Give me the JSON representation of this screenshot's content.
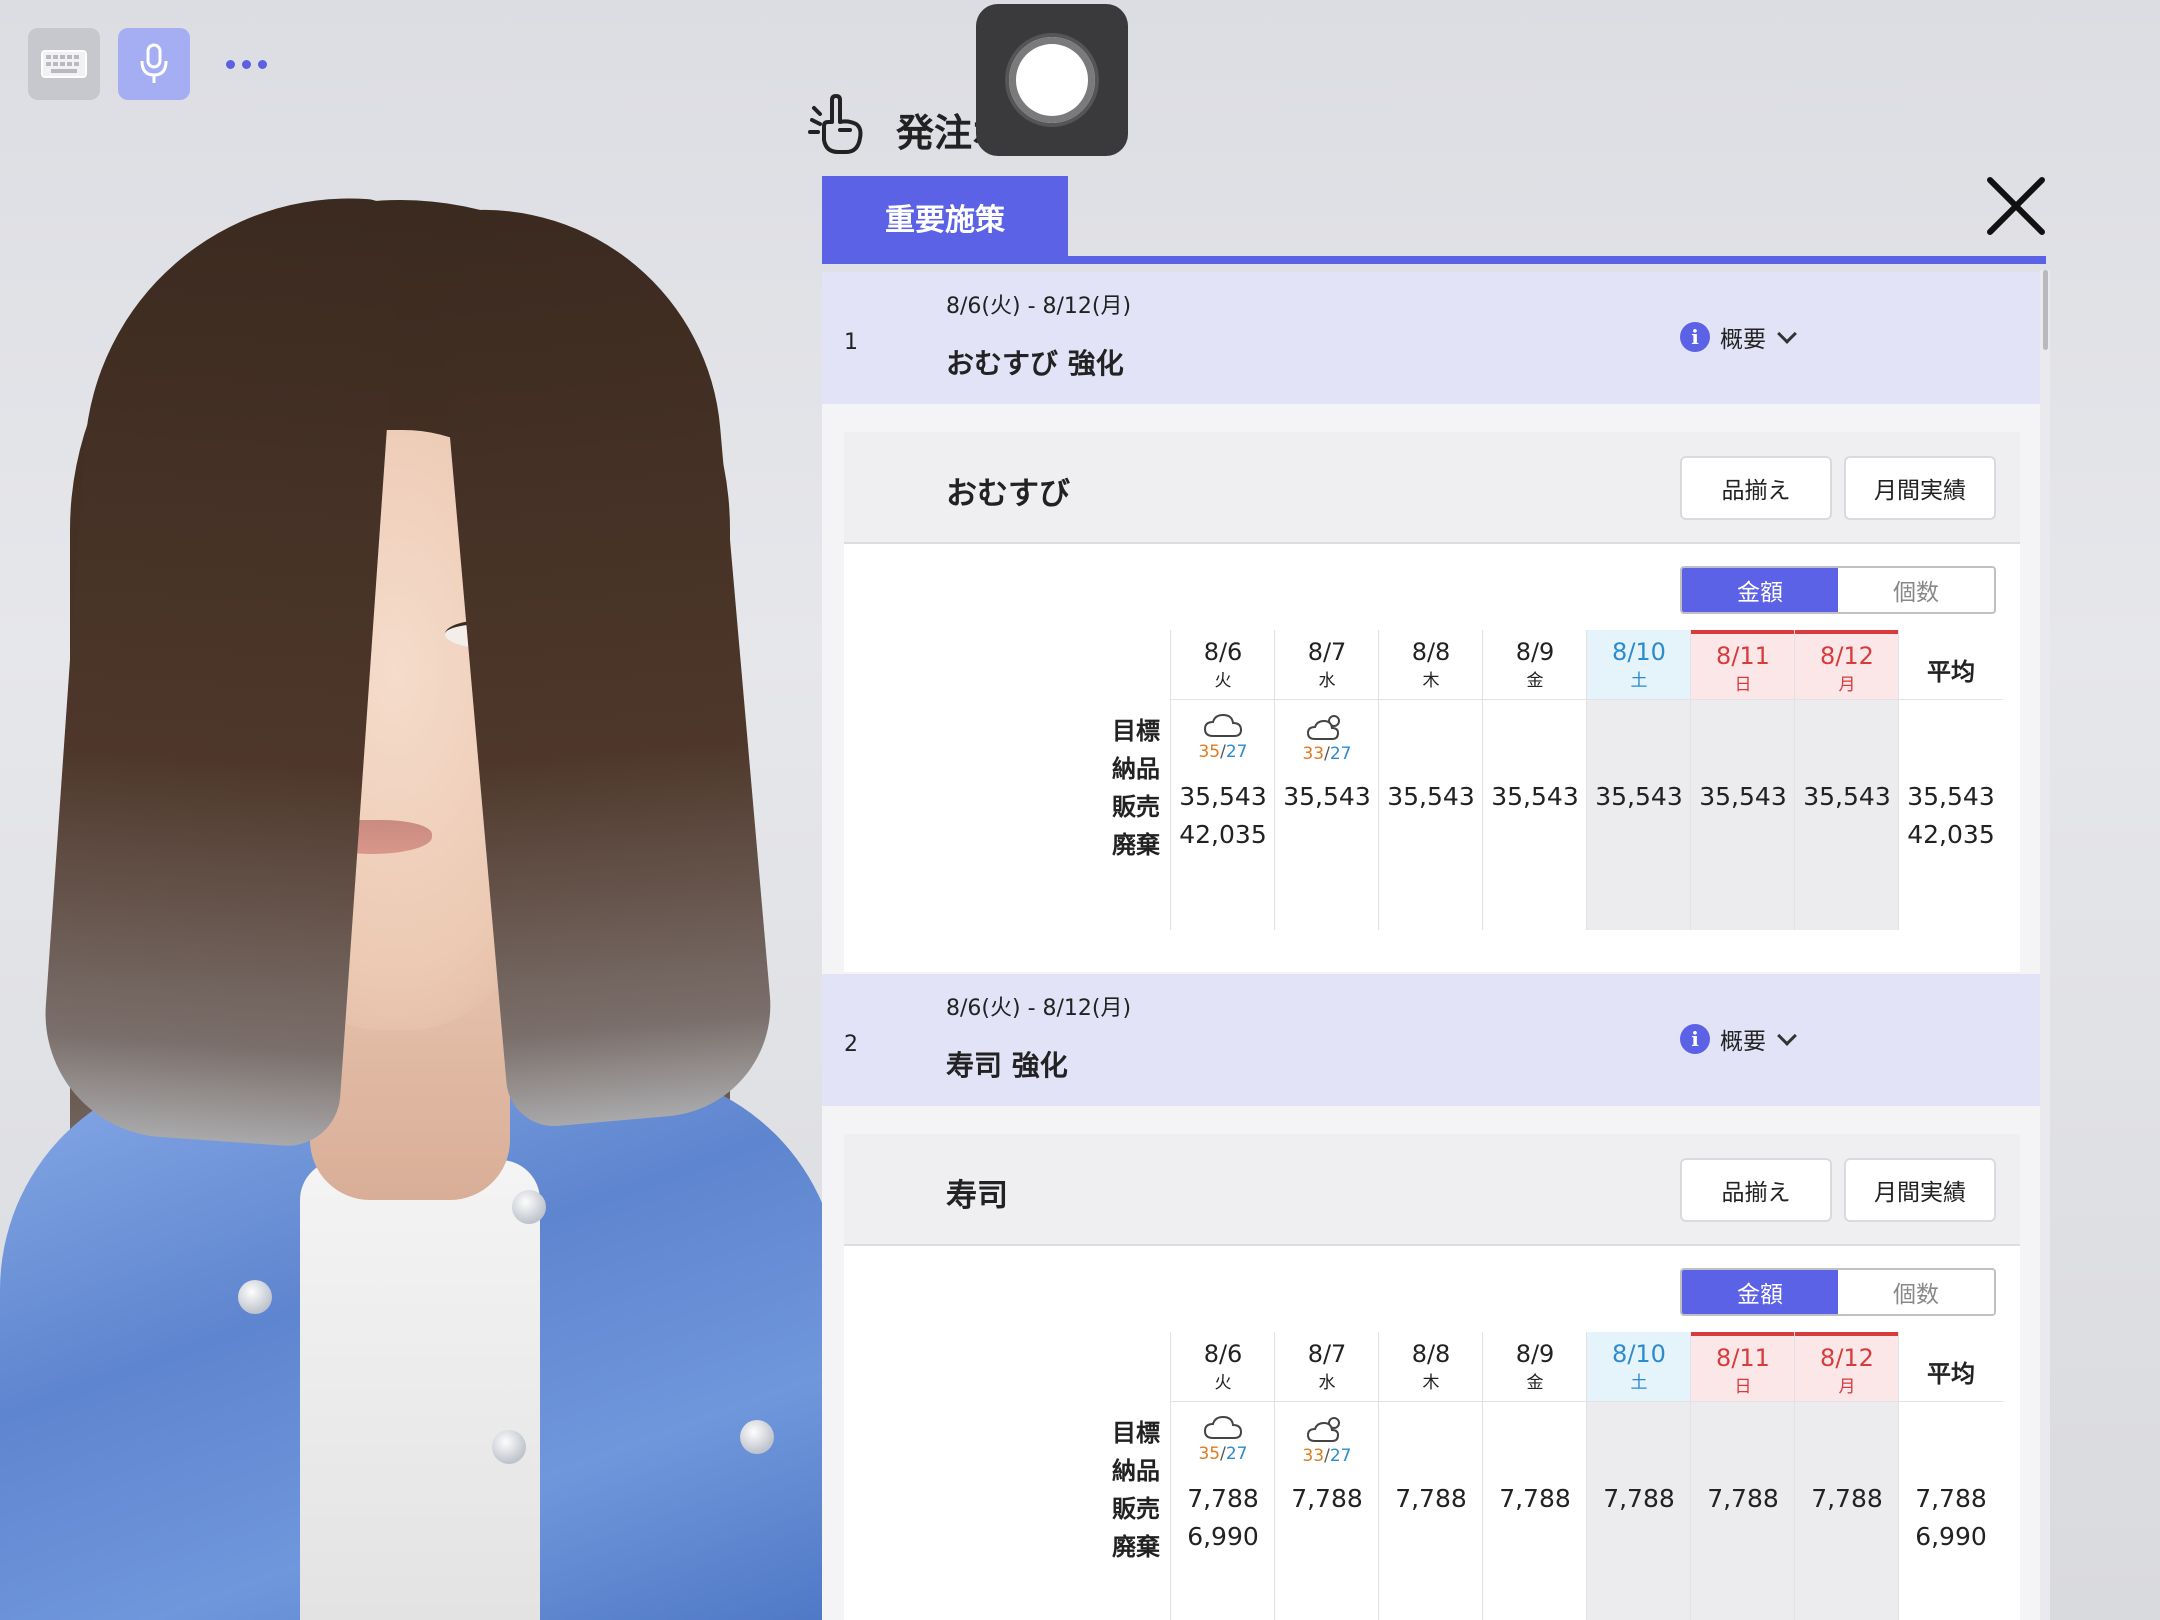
{
  "header": {
    "point_title": "発注ポイント",
    "active_tab": "重要施策"
  },
  "toolbar": {
    "keyboard_icon": "keyboard-icon",
    "mic_icon": "microphone-icon",
    "more_icon": "more-dots-icon"
  },
  "colors": {
    "accent": "#5c62e6",
    "header_bg": "#e3e3f8",
    "saturday": "#2b8bd0",
    "holiday": "#d83b3b",
    "temp_high": "#e07a1f",
    "temp_low": "#2b8bd0"
  },
  "summary_label": "概要",
  "buttons": {
    "lineup": "品揃え",
    "monthly": "月間実績"
  },
  "toggle": {
    "amount": "金額",
    "count": "個数",
    "selected": "金額"
  },
  "row_labels": [
    "目標",
    "納品",
    "販売",
    "廃棄"
  ],
  "columns": [
    {
      "date": "8/6",
      "weekday": "火",
      "type": "weekday"
    },
    {
      "date": "8/7",
      "weekday": "水",
      "type": "weekday"
    },
    {
      "date": "8/8",
      "weekday": "木",
      "type": "weekday"
    },
    {
      "date": "8/9",
      "weekday": "金",
      "type": "weekday"
    },
    {
      "date": "8/10",
      "weekday": "土",
      "type": "saturday"
    },
    {
      "date": "8/11",
      "weekday": "日",
      "type": "holiday"
    },
    {
      "date": "8/12",
      "weekday": "月",
      "type": "holiday"
    }
  ],
  "avg_label": "平均",
  "weather": [
    {
      "icon": "cloudy-icon",
      "high": "35",
      "low": "27"
    },
    {
      "icon": "partly-cloudy-icon",
      "high": "33",
      "low": "27"
    }
  ],
  "sections": [
    {
      "num": "1",
      "dates": "8/6(火) - 8/12(月)",
      "title": "おむすび 強化",
      "card_title": "おむすび",
      "target": [
        "35,543",
        "35,543",
        "35,543",
        "35,543",
        "35,543",
        "35,543",
        "35,543",
        "35,543"
      ],
      "delivery_first": "42,035",
      "delivery_avg": "42,035"
    },
    {
      "num": "2",
      "dates": "8/6(火) - 8/12(月)",
      "title": "寿司 強化",
      "card_title": "寿司",
      "target": [
        "7,788",
        "7,788",
        "7,788",
        "7,788",
        "7,788",
        "7,788",
        "7,788",
        "7,788"
      ],
      "delivery_first": "6,990",
      "delivery_avg": "6,990"
    }
  ]
}
